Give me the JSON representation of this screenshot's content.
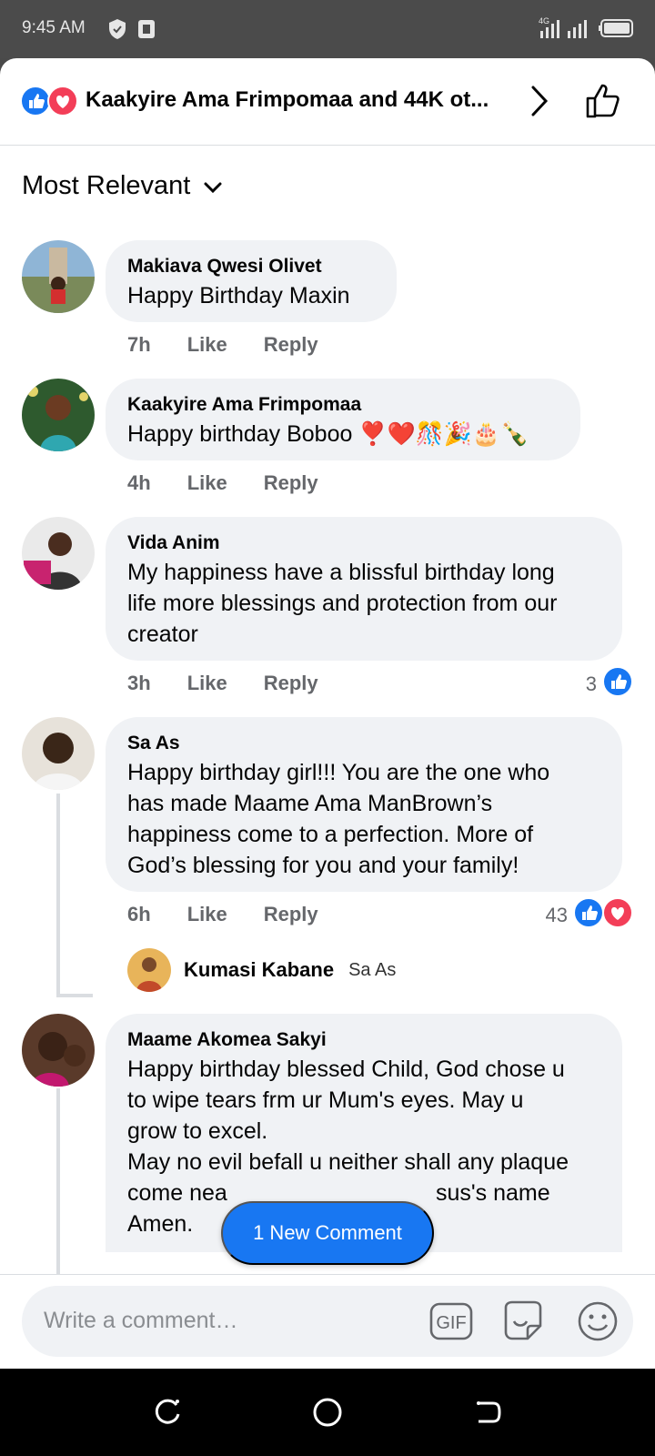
{
  "status_bar": {
    "time": "9:45 AM",
    "network": "4G"
  },
  "header": {
    "title": "Kaakyire Ama Frimpomaa and 44K ot..."
  },
  "sort": {
    "label": "Most Relevant"
  },
  "comments": [
    {
      "name": "Makiava Qwesi Olivet",
      "lines": [
        "Happy Birthday Maxin"
      ],
      "time": "7h",
      "like": "Like",
      "reply": "Reply"
    },
    {
      "name": "Kaakyire Ama Frimpomaa",
      "lines": [
        "Happy birthday Boboo ❣️❤️🎊🎉🎂🍾"
      ],
      "time": "4h",
      "like": "Like",
      "reply": "Reply"
    },
    {
      "name": "Vida Anim",
      "lines": [
        "My happiness have a blissful birthday long",
        "life more blessings and protection from our",
        "creator"
      ],
      "time": "3h",
      "like": "Like",
      "reply": "Reply",
      "reaction_count": "3"
    },
    {
      "name": "Sa As",
      "lines": [
        "Happy birthday girl!!! You are the one who",
        "has made Maame Ama ManBrown’s",
        "happiness come to a perfection. More of",
        "God’s blessing for you and your family!"
      ],
      "time": "6h",
      "like": "Like",
      "reply": "Reply",
      "reaction_count": "43"
    },
    {
      "name": "Maame Akomea Sakyi",
      "lines": [
        "Happy birthday blessed Child, God chose u",
        "to wipe tears frm ur Mum's eyes. May u",
        "grow to excel.",
        "May no evil befall u neither shall any plaque",
        "come nea                                 sus's name",
        "Amen."
      ]
    }
  ],
  "reply_preview": {
    "name": "Kumasi Kabane",
    "reply_to": "Sa As"
  },
  "new_comment_button": "1 New Comment",
  "composer": {
    "placeholder": "Write a comment…",
    "gif_label": "GIF"
  },
  "colors": {
    "brand_blue": "#1877f2",
    "love_red": "#f33e58",
    "bubble_bg": "#f0f2f5",
    "meta_gray": "#65676b"
  },
  "icons": [
    "shield-icon",
    "sim-icon",
    "signal-icon",
    "battery-icon",
    "like-reaction-icon",
    "love-reaction-icon",
    "chevron-right-icon",
    "thumbs-up-icon",
    "chevron-down-icon",
    "gif-icon",
    "sticker-icon",
    "emoji-icon",
    "recents-icon",
    "home-icon",
    "back-icon"
  ]
}
